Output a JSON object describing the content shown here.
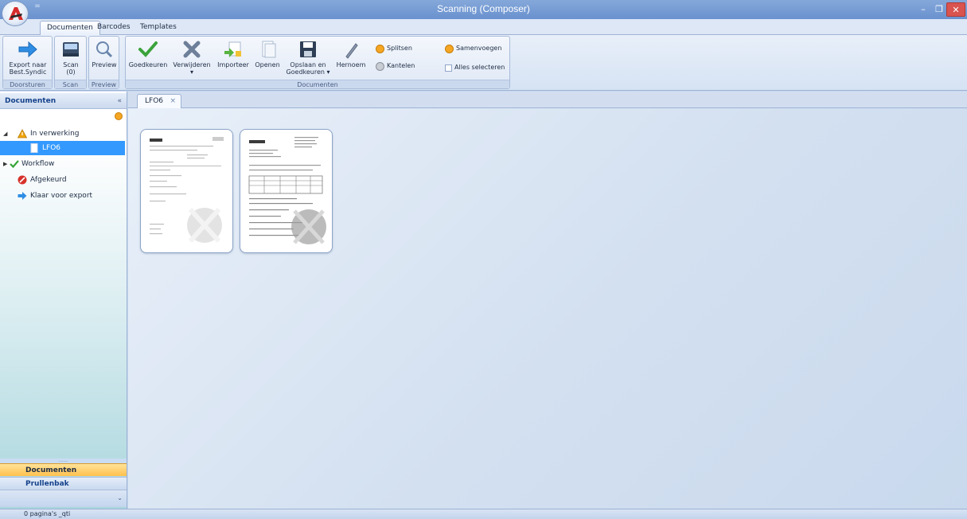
{
  "window": {
    "title": "Scanning (Composer)",
    "qat_glyph": "=",
    "min": "–",
    "max": "❐",
    "close": "✕"
  },
  "ribbon_tabs": [
    "Documenten",
    "Barcodes",
    "Templates"
  ],
  "ribbon": {
    "export_label_1": "Export naar",
    "export_label_2": "Best.Syndic",
    "scan_label": "Scan",
    "scan_count": "(0)",
    "preview_label": "Preview",
    "approve_label": "Goedkeuren",
    "delete_label": "Verwijderen",
    "delete_arrow": "▾",
    "import_label": "Importeer",
    "open_label": "Openen",
    "save_label_1": "Opslaan en",
    "save_label_2": "Goedkeuren ▾",
    "rename_label": "Hernoem",
    "split_label": "Splitsen",
    "rotate_label": "Kantelen",
    "merge_label": "Samenvoegen",
    "select_all_label": "Alles selecteren",
    "group_forward": "Doorsturen",
    "group_scan": "Scan",
    "group_preview": "Preview",
    "group_documents": "Documenten"
  },
  "left_panel": {
    "title": "Documenten",
    "collapse": "«",
    "tree": [
      {
        "label": "In verwerking",
        "expander": "◢",
        "icon": "warning-icon"
      },
      {
        "label": "LFO6",
        "icon": "document-icon",
        "selected": true
      },
      {
        "label": "Workflow",
        "expander": "▶",
        "icon": "checkmark-icon"
      },
      {
        "label": "Afgekeurd",
        "icon": "reject-icon"
      },
      {
        "label": "Klaar voor export",
        "icon": "arrow-right-icon"
      }
    ],
    "grip": "......",
    "nav_documents": "Documenten",
    "nav_trash": "Prullenbak",
    "nav_more": "⌄"
  },
  "doc_tabs": [
    {
      "label": "LFO6",
      "close": "×"
    }
  ],
  "status": "0 pagina's _qti",
  "colors": {
    "accent": "#3399ff",
    "nav_active": "#ffc04d",
    "title_bar": "#6a91cf",
    "close": "#d9534f"
  }
}
